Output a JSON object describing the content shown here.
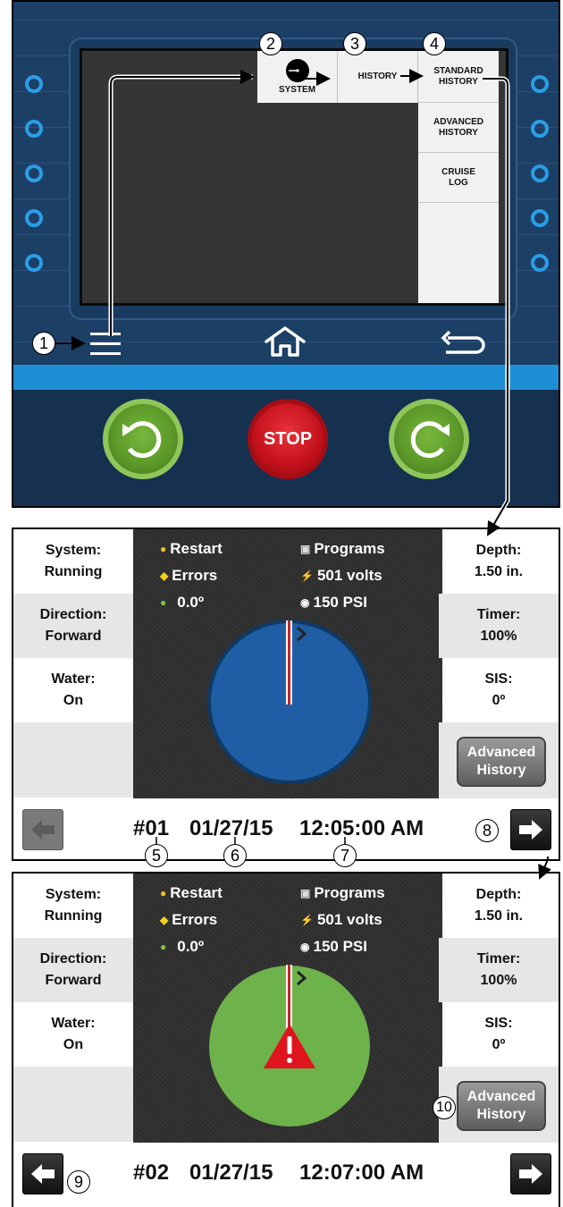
{
  "controller": {
    "menu": {
      "system_label": "SYSTEM",
      "history_label": "HISTORY",
      "standard_history_label": "STANDARD HISTORY",
      "advanced_history_label": "ADVANCED HISTORY",
      "cruise_log_label": "CRUISE LOG"
    },
    "stop_label": "STOP",
    "icons": {
      "menu": "menu-icon",
      "home": "home-icon",
      "back": "back-arrow-icon",
      "reverse": "rotate-left-icon",
      "forward": "rotate-right-icon"
    }
  },
  "callouts": [
    "1",
    "2",
    "3",
    "4",
    "5",
    "6",
    "7",
    "8",
    "9",
    "10"
  ],
  "records": [
    {
      "left": {
        "system_label": "System:",
        "system_value": "Running",
        "direction_label": "Direction:",
        "direction_value": "Forward",
        "water_label": "Water:",
        "water_value": "On"
      },
      "right": {
        "depth_label": "Depth:",
        "depth_value": "1.50 in.",
        "timer_label": "Timer:",
        "timer_value": "100%",
        "sis_label": "SIS:",
        "sis_value": "0º"
      },
      "status": {
        "restart": "Restart",
        "errors": "Errors",
        "angle": "0.0º",
        "programs": "Programs",
        "volts": "501 volts",
        "pressure": "150 PSI"
      },
      "advanced_button": "Advanced History",
      "record_number": "#01",
      "date": "01/27/15",
      "time": "12:05:00 AM",
      "pie_color": "#1f5ea4",
      "warning": false
    },
    {
      "left": {
        "system_label": "System:",
        "system_value": "Running",
        "direction_label": "Direction:",
        "direction_value": "Forward",
        "water_label": "Water:",
        "water_value": "On"
      },
      "right": {
        "depth_label": "Depth:",
        "depth_value": "1.50 in.",
        "timer_label": "Timer:",
        "timer_value": "100%",
        "sis_label": "SIS:",
        "sis_value": "0º"
      },
      "status": {
        "restart": "Restart",
        "errors": "Errors",
        "angle": "0.0º",
        "programs": "Programs",
        "volts": "501 volts",
        "pressure": "150 PSI"
      },
      "advanced_button": "Advanced History",
      "record_number": "#02",
      "date": "01/27/15",
      "time": "12:07:00 AM",
      "pie_color": "#6db24a",
      "warning": true
    }
  ]
}
